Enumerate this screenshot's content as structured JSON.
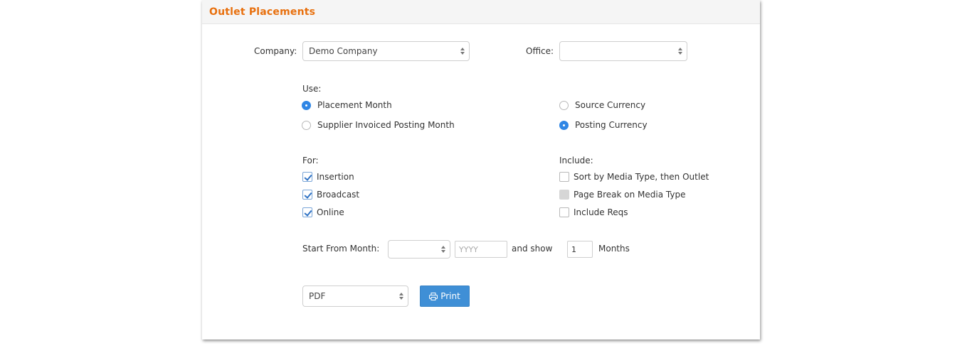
{
  "header": {
    "title": "Outlet Placements"
  },
  "company": {
    "label": "Company:",
    "value": "Demo Company"
  },
  "office": {
    "label": "Office:",
    "value": ""
  },
  "use": {
    "label": "Use:",
    "month_options": [
      {
        "label": "Placement Month",
        "checked": true
      },
      {
        "label": "Supplier Invoiced Posting Month",
        "checked": false
      }
    ],
    "currency_options": [
      {
        "label": "Source Currency",
        "checked": false
      },
      {
        "label": "Posting Currency",
        "checked": true
      }
    ]
  },
  "for": {
    "label": "For:",
    "items": [
      {
        "label": "Insertion",
        "checked": true
      },
      {
        "label": "Broadcast",
        "checked": true
      },
      {
        "label": "Online",
        "checked": true
      }
    ]
  },
  "include": {
    "label": "Include:",
    "items": [
      {
        "label": "Sort by Media Type, then Outlet",
        "checked": false,
        "disabled": false
      },
      {
        "label": "Page Break on Media Type",
        "checked": false,
        "disabled": true
      },
      {
        "label": "Include Reqs",
        "checked": false,
        "disabled": false
      }
    ]
  },
  "start": {
    "label": "Start From Month:",
    "month_value": "",
    "year_placeholder": "YYYY",
    "and_show": "and show",
    "months_value": "1",
    "months_label": "Months"
  },
  "output": {
    "format": "PDF",
    "print_label": "Print"
  },
  "colors": {
    "accent": "#e8700e",
    "primary": "#3f8fd6",
    "radio": "#2f86e5"
  }
}
